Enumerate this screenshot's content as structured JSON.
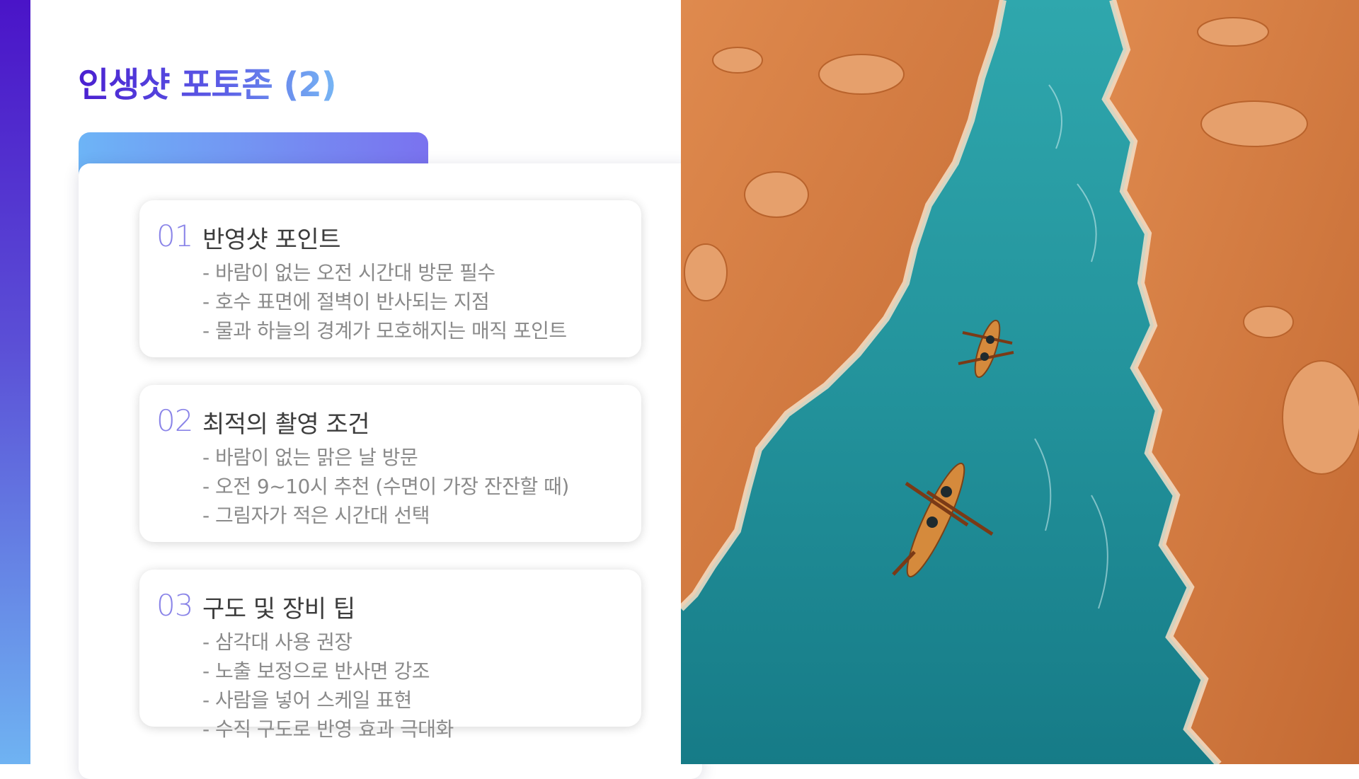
{
  "slide": {
    "title": "인생샷 포토존 (2)",
    "accent_colors": [
      "#4a14c8",
      "#6fb3f2",
      "#7a72ef"
    ]
  },
  "cards": [
    {
      "number": "01",
      "heading": "반영샷 포인트",
      "lines": [
        "- 바람이 없는 오전 시간대 방문 필수",
        "- 호수 표면에 절벽이 반사되는 지점",
        "- 물과 하늘의 경계가 모호해지는 매직 포인트"
      ]
    },
    {
      "number": "02",
      "heading": "최적의 촬영 조건",
      "lines": [
        "- 바람이 없는 맑은 날 방문",
        "- 오전 9~10시 추천 (수면이 가장 잔잔할 때)",
        "- 그림자가 적은 시간대 선택"
      ]
    },
    {
      "number": "03",
      "heading": "구도 및 장비 팁",
      "lines": [
        "- 삼각대 사용 권장",
        "- 노출 보정으로 반사면 강조",
        "- 사람을 넣어 스케일 표현",
        "- 수직 구도로 반영 효과 극대화"
      ]
    }
  ],
  "photo": {
    "subject": "aerial-canyon-river-kayaks"
  }
}
